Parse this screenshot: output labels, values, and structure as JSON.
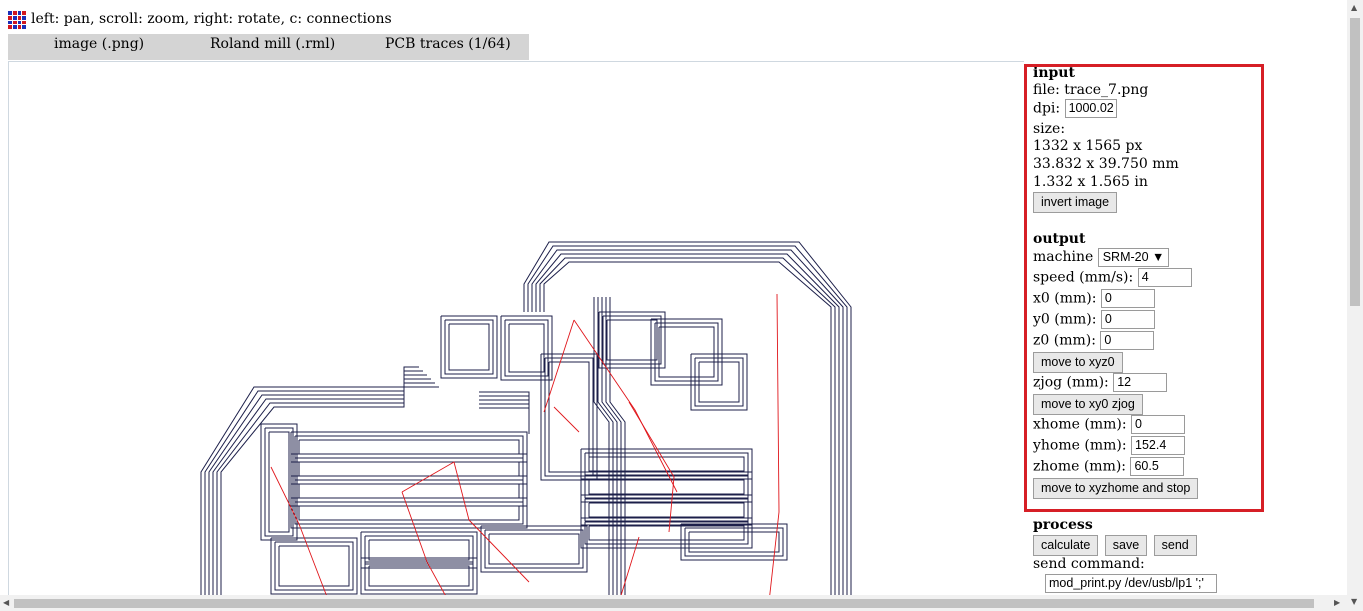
{
  "header": {
    "hint": "left: pan, scroll: zoom, right: rotate, c: connections",
    "logo_icon": "fab-modules-icon"
  },
  "tabs": [
    {
      "label": "image (.png)"
    },
    {
      "label": "Roland mill (.rml)"
    },
    {
      "label": "PCB traces (1/64)"
    }
  ],
  "input": {
    "heading": "input",
    "file": "file: trace_7.png",
    "dpi_label": "dpi:",
    "dpi_value": "1000.02",
    "size_label": "size:",
    "size_px": "1332 x 1565 px",
    "size_mm": "33.832 x 39.750 mm",
    "size_in": "1.332 x 1.565 in",
    "invert_button": "invert image"
  },
  "output": {
    "heading": "output",
    "machine_label": "machine",
    "machine_value": "SRM-20",
    "speed_label": "speed (mm/s):",
    "speed_value": "4",
    "x0_label": "x0 (mm):",
    "x0_value": "0",
    "y0_label": "y0 (mm):",
    "y0_value": "0",
    "z0_label": "z0 (mm):",
    "z0_value": "0",
    "move_xyz0_button": "move to xyz0",
    "zjog_label": "zjog (mm):",
    "zjog_value": "12",
    "move_xy0_zjog_button": "move to xy0 zjog",
    "xhome_label": "xhome (mm):",
    "xhome_value": "0",
    "yhome_label": "yhome (mm):",
    "yhome_value": "152.4",
    "zhome_label": "zhome (mm):",
    "zhome_value": "60.5",
    "move_home_button": "move to xyzhome and stop"
  },
  "process": {
    "heading": "process",
    "calculate_button": "calculate",
    "save_button": "save",
    "send_button": "send",
    "send_command_label": "send command:",
    "send_command_value": "mod_print.py /dev/usb/lp1 ';'"
  },
  "colors": {
    "highlight": "#d61f26",
    "trace": "#1c1f4a",
    "connection": "#e0161b",
    "tab_bg": "#d4d4d4"
  }
}
